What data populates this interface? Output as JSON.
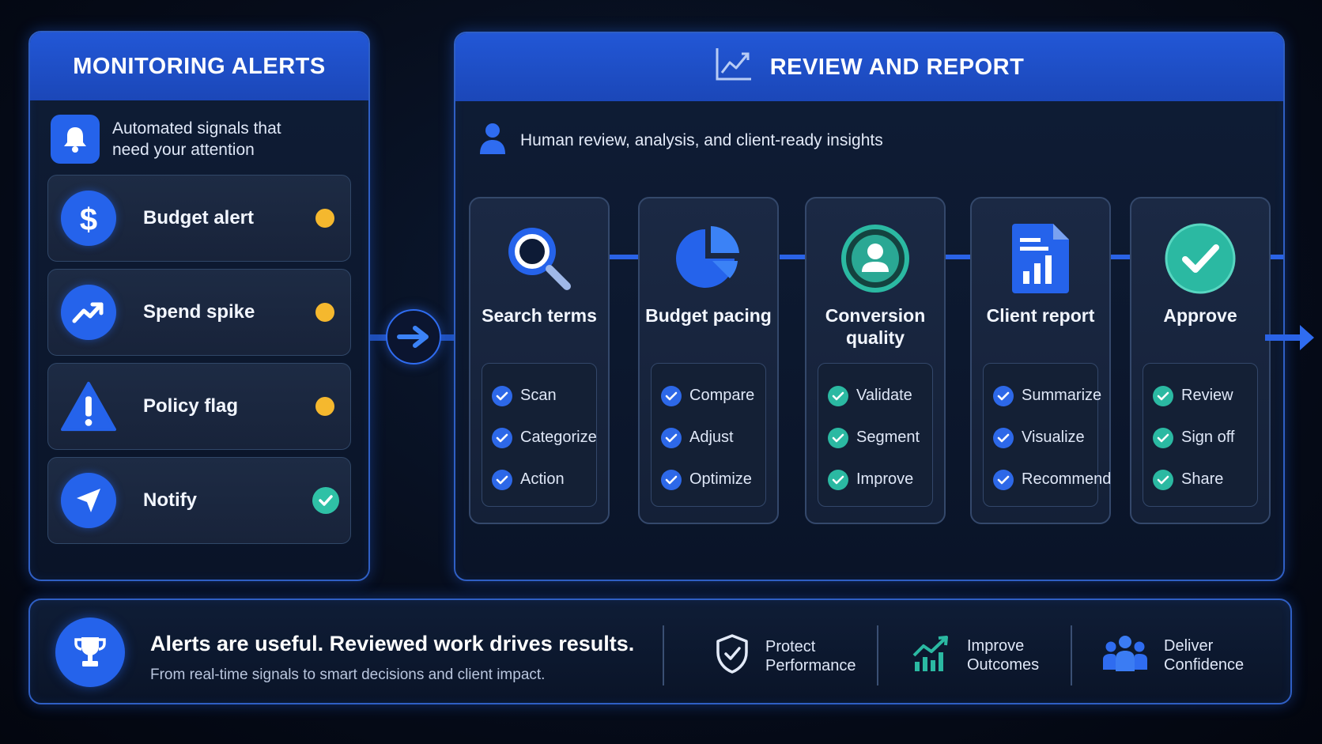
{
  "monitoring": {
    "title": "MONITORING ALERTS",
    "intro": "Automated signals that need your attention",
    "alerts": [
      {
        "label": "Budget alert",
        "icon": "dollar-icon",
        "status": "pending"
      },
      {
        "label": "Spend spike",
        "icon": "trend-up-icon",
        "status": "pending"
      },
      {
        "label": "Policy flag",
        "icon": "warning-icon",
        "status": "pending"
      },
      {
        "label": "Notify",
        "icon": "send-icon",
        "status": "done"
      }
    ]
  },
  "review": {
    "title": "REVIEW AND REPORT",
    "subtitle": "Human review, analysis, and client-ready insights",
    "steps": [
      {
        "title": "Search terms",
        "icon": "search-icon",
        "items": [
          "Scan",
          "Categorize",
          "Action"
        ]
      },
      {
        "title": "Budget pacing",
        "icon": "pie-chart-icon",
        "items": [
          "Compare",
          "Adjust",
          "Optimize"
        ]
      },
      {
        "title": "Conversion quality",
        "icon": "user-circle-icon",
        "items": [
          "Validate",
          "Segment",
          "Improve"
        ]
      },
      {
        "title": "Client report",
        "icon": "report-document-icon",
        "items": [
          "Summarize",
          "Visualize",
          "Recommend"
        ]
      },
      {
        "title": "Approve",
        "icon": "check-circle-icon",
        "items": [
          "Review",
          "Sign off",
          "Share"
        ]
      }
    ]
  },
  "footer": {
    "headline": "Alerts are useful. Reviewed work drives results.",
    "subline": "From real-time signals to smart decisions and client impact.",
    "benefits": [
      {
        "line1": "Protect",
        "line2": "Performance",
        "icon": "shield-check-icon"
      },
      {
        "line1": "Improve",
        "line2": "Outcomes",
        "icon": "growth-chart-icon"
      },
      {
        "line1": "Deliver",
        "line2": "Confidence",
        "icon": "team-icon"
      }
    ]
  },
  "colors": {
    "accent_blue": "#2563eb",
    "pending_yellow": "#f5b82e",
    "done_teal": "#2fc1a6",
    "background": "#060c1a"
  }
}
